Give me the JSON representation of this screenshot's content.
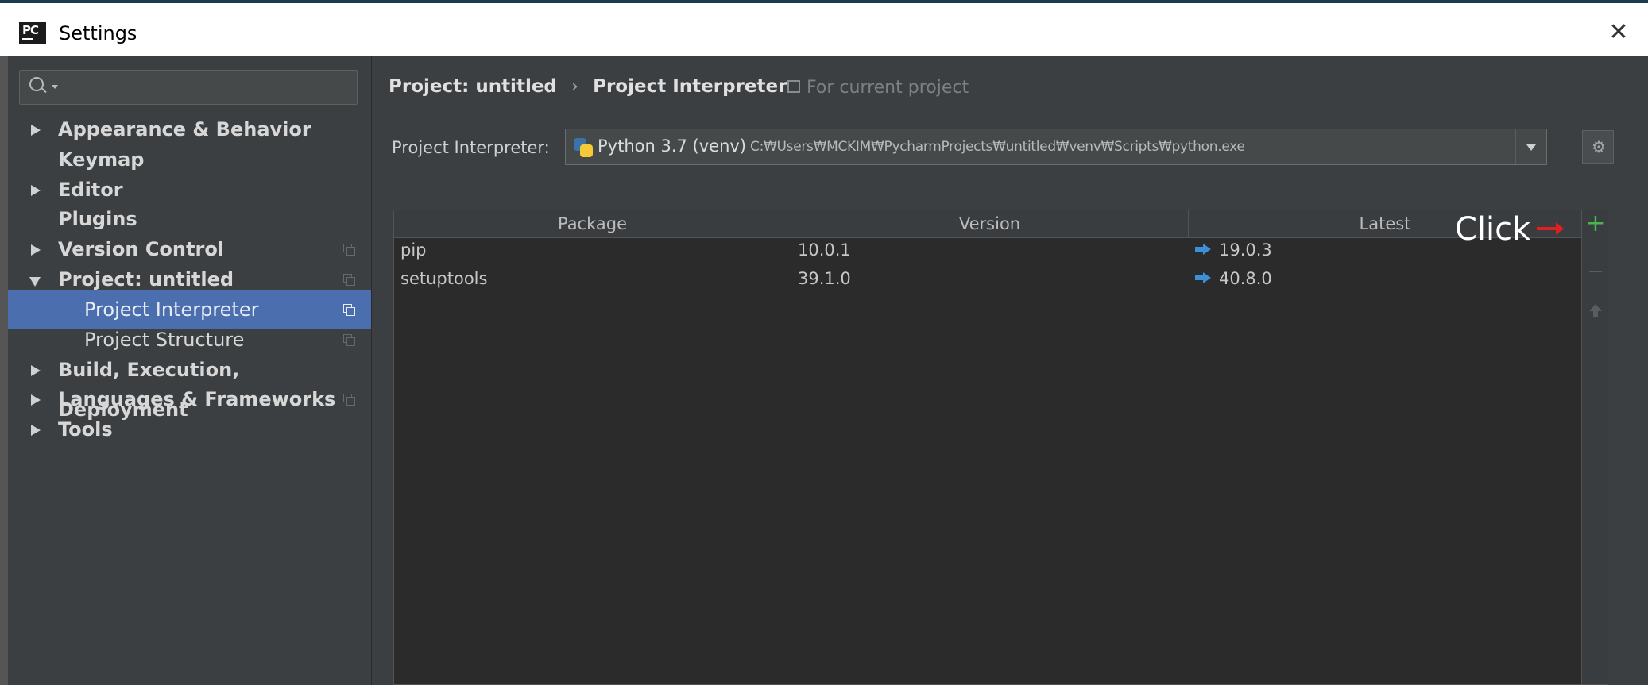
{
  "window": {
    "app_icon_text": "PC",
    "title": "Settings",
    "close_glyph": "✕"
  },
  "search": {
    "placeholder": "",
    "value": ""
  },
  "sidebar": {
    "items": [
      {
        "label": "Appearance & Behavior",
        "expandable": true,
        "expanded": false
      },
      {
        "label": "Keymap",
        "expandable": false
      },
      {
        "label": "Editor",
        "expandable": true,
        "expanded": false
      },
      {
        "label": "Plugins",
        "expandable": false
      },
      {
        "label": "Version Control",
        "expandable": true,
        "expanded": false
      },
      {
        "label": "Project: untitled",
        "expandable": true,
        "expanded": true
      },
      {
        "label": "Project Interpreter",
        "child": true,
        "selected": true
      },
      {
        "label": "Project Structure",
        "child": true
      },
      {
        "label": "Build, Execution, Deployment",
        "expandable": true,
        "expanded": false
      },
      {
        "label": "Languages & Frameworks",
        "expandable": true,
        "expanded": false
      },
      {
        "label": "Tools",
        "expandable": true,
        "expanded": false
      }
    ]
  },
  "breadcrumb": {
    "parent": "Project: untitled",
    "separator": "›",
    "current": "Project Interpreter",
    "scope_note": "For current project"
  },
  "interpreter": {
    "label": "Project Interpreter:",
    "name": "Python 3.7 (venv)",
    "path": "C:₩Users₩MCKIM₩PycharmProjects₩untitled₩venv₩Scripts₩python.exe"
  },
  "packages": {
    "columns": [
      "Package",
      "Version",
      "Latest"
    ],
    "rows": [
      {
        "package": "pip",
        "version": "10.0.1",
        "latest": "19.0.3"
      },
      {
        "package": "setuptools",
        "version": "39.1.0",
        "latest": "40.8.0"
      }
    ],
    "add_glyph": "+"
  },
  "annotation": {
    "text": "Click"
  },
  "colors": {
    "background": "#3c3f41",
    "selection": "#4b6eaf",
    "add_button": "#48b74a",
    "update_arrow": "#3d8fd6",
    "annotation_arrow": "#e02020"
  }
}
